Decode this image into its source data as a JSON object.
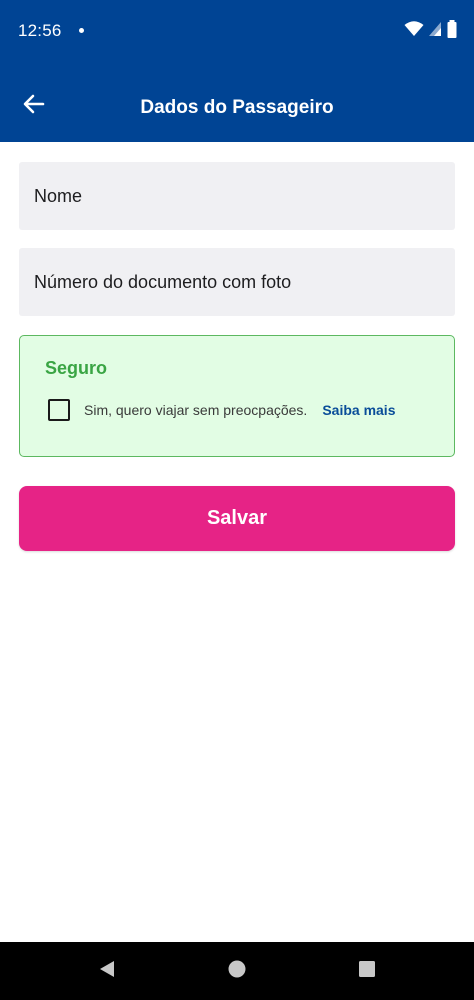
{
  "status_bar": {
    "time": "12:56",
    "icons": [
      "notification-dot-icon",
      "wifi-icon",
      "signal-icon",
      "battery-icon"
    ]
  },
  "app_bar": {
    "title": "Dados do Passageiro",
    "back_icon": "arrow-left-icon"
  },
  "form": {
    "name_placeholder": "Nome",
    "document_placeholder": "Número do documento com foto"
  },
  "insurance": {
    "title": "Seguro",
    "checkbox_label": "Sim, quero viajar sem preocpações.",
    "checked": false,
    "link_label": "Saiba mais"
  },
  "actions": {
    "save_label": "Salvar"
  },
  "nav_bar": {
    "icons": [
      "nav-back-icon",
      "nav-home-icon",
      "nav-recents-icon"
    ]
  },
  "colors": {
    "primary": "#004494",
    "accent": "#e62386",
    "insurance_bg": "#e2fde4",
    "insurance_border": "#5cb860",
    "insurance_title": "#3aa544",
    "link": "#0a4d99",
    "field_bg": "#f0f0f3"
  }
}
